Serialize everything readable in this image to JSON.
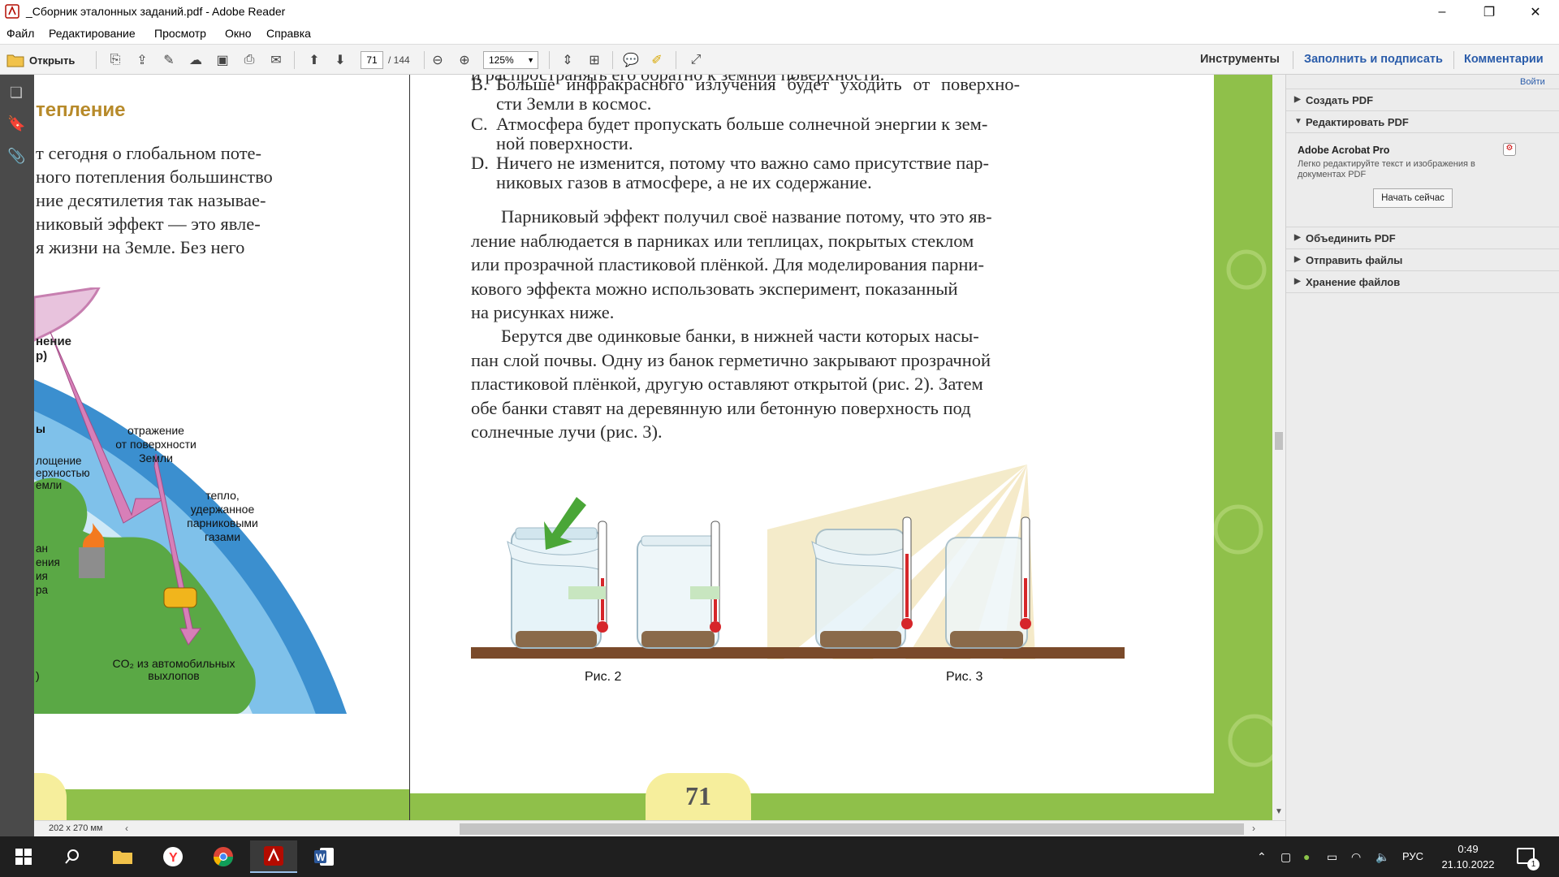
{
  "window": {
    "title": "_Сборник эталонных заданий.pdf - Adobe Reader",
    "minimize": "–",
    "restore": "❐",
    "close": "✕"
  },
  "menu": [
    "Файл",
    "Редактирование",
    "Просмотр",
    "Окно",
    "Справка"
  ],
  "toolbar": {
    "open_label": "Открыть",
    "page_current": "71",
    "page_total": "/ 144",
    "zoom": "125%",
    "tools": "Инструменты",
    "fill_sign": "Заполнить и подписать",
    "comments": "Комментарии"
  },
  "right_panel": {
    "signin": "Войти",
    "sections": [
      {
        "label": "Создать PDF",
        "expanded": false
      },
      {
        "label": "Редактировать PDF",
        "expanded": true
      },
      {
        "label": "Объединить PDF",
        "expanded": false
      },
      {
        "label": "Отправить файлы",
        "expanded": false
      },
      {
        "label": "Хранение файлов",
        "expanded": false
      }
    ],
    "promo_title": "Adobe Acrobat Pro",
    "promo_text": "Легко редактируйте текст и изображения в документах PDF",
    "promo_button": "Начать сейчас"
  },
  "left_page": {
    "heading": "тепление",
    "lines": [
      "т сегодня о глобальном поте-",
      "ного потепления большинство",
      "ние десятилетия так называе-",
      "никовый эффект — это явле-",
      "я жизни на Земле. Без него"
    ],
    "diagram_labels": {
      "funnel_line1": "нение",
      "funnel_line2": "р)",
      "left_a": "ы",
      "left_b1": "лощение",
      "left_b2": "ерхностью",
      "left_b3": "емли",
      "left_c1": "ан",
      "left_c2": "ения",
      "left_c3": "ия",
      "left_c4": "ра",
      "left_d": ")",
      "reflection1": "отражение",
      "reflection2": "от поверхности",
      "reflection3": "Земли",
      "heat1": "тепло,",
      "heat2": "удержанное",
      "heat3": "парниковыми",
      "heat4": "газами",
      "co2_1": "CO₂ из автомобильных",
      "co2_2": "выхлопов"
    }
  },
  "right_page": {
    "top_partial": "и распространять его обратно к земной поверхности.",
    "options": [
      {
        "letter": "B.",
        "line1": "Больше инфракрасного излучения будет уходить от поверхно-",
        "line2": "сти Земли в космос."
      },
      {
        "letter": "C.",
        "line1": "Атмосфера будет пропускать больше солнечной энергии к зем-",
        "line2": "ной поверхности."
      },
      {
        "letter": "D.",
        "line1": "Ничего не изменится, потому что важно само присутствие пар-",
        "line2": "никовых газов в атмосфере, а не их содержание."
      }
    ],
    "para1": [
      "Парниковый эффект получил своё название потому, что это яв-",
      "ление наблюдается в парниках или теплицах, покрытых стеклом",
      "или прозрачной пластиковой плёнкой. Для моделирования парни-",
      "кового эффекта можно использовать эксперимент, показанный",
      "на рисунках ниже."
    ],
    "para2": [
      "Берутся две одинковые банки, в нижней части которых насы-",
      "пан слой почвы. Одну из банок герметично закрывают прозрачной",
      "пластиковой плёнкой, другую оставляют открытой (рис. 2). Затем",
      "обе банки ставят на деревянную или бетонную поверхность под",
      "солнечные лучи (рис. 3)."
    ],
    "fig2": "Рис. 2",
    "fig3": "Рис. 3",
    "page_number": "71"
  },
  "statusbar": {
    "page_size": "202 x 270 мм"
  },
  "taskbar": {
    "lang": "РУС",
    "time": "0:49",
    "date": "21.10.2022",
    "notif_count": "1"
  },
  "colors": {
    "heading_gold": "#b78a2a",
    "page_green": "#8fc04a",
    "arrow_pink": "#c77fb0",
    "arrow_green": "#4aa637",
    "thermo_red": "#d6262a",
    "wood": "#7a4a2a"
  }
}
